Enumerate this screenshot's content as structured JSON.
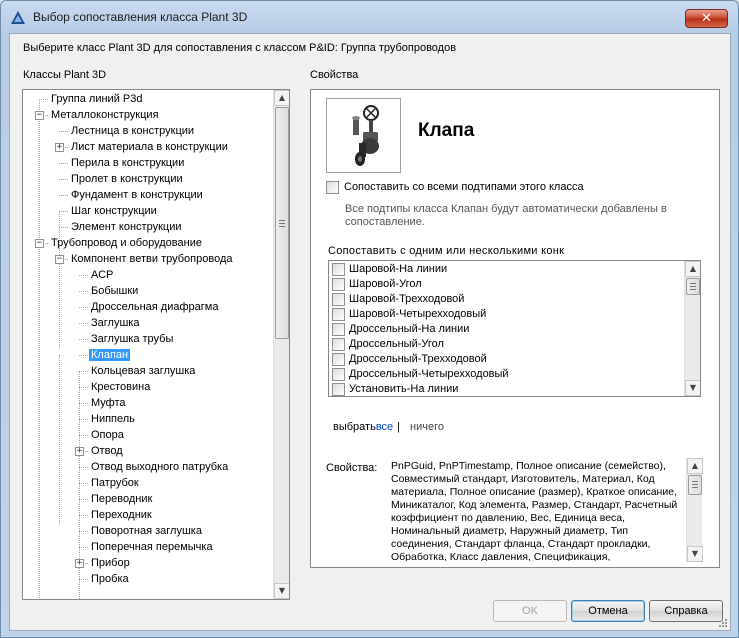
{
  "window": {
    "title": "Выбор сопоставления класса Plant 3D",
    "close_glyph": "✕"
  },
  "instruction": "Выберите класс Plant 3D для сопоставления с классом P&ID: Группа трубопроводов",
  "classes_label": "Классы Plant 3D",
  "properties_header": "Свойства",
  "tree": {
    "nodes": [
      {
        "label": "Группа линий P3d",
        "level": 0,
        "expander": ""
      },
      {
        "label": "Металлоконструкция",
        "level": 0,
        "expander": "−"
      },
      {
        "label": "Лестница в конструкции",
        "level": 1,
        "expander": ""
      },
      {
        "label": "Лист материала в конструкции",
        "level": 1,
        "expander": "+"
      },
      {
        "label": "Перила в конструкции",
        "level": 1,
        "expander": ""
      },
      {
        "label": "Пролет в конструкции",
        "level": 1,
        "expander": ""
      },
      {
        "label": "Фундамент в конструкции",
        "level": 1,
        "expander": ""
      },
      {
        "label": "Шаг конструкции",
        "level": 1,
        "expander": ""
      },
      {
        "label": "Элемент конструкции",
        "level": 1,
        "expander": ""
      },
      {
        "label": "Трубопровод и оборудование",
        "level": 0,
        "expander": "−"
      },
      {
        "label": "Компонент ветви трубопровода",
        "level": 1,
        "expander": "−"
      },
      {
        "label": "АСР",
        "level": 2,
        "expander": ""
      },
      {
        "label": "Бобышки",
        "level": 2,
        "expander": ""
      },
      {
        "label": "Дроссельная диафрагма",
        "level": 2,
        "expander": ""
      },
      {
        "label": "Заглушка",
        "level": 2,
        "expander": ""
      },
      {
        "label": "Заглушка трубы",
        "level": 2,
        "expander": ""
      },
      {
        "label": "Клапан",
        "level": 2,
        "expander": "",
        "selected": true
      },
      {
        "label": "Кольцевая заглушка",
        "level": 2,
        "expander": ""
      },
      {
        "label": "Крестовина",
        "level": 2,
        "expander": ""
      },
      {
        "label": "Муфта",
        "level": 2,
        "expander": ""
      },
      {
        "label": "Ниппель",
        "level": 2,
        "expander": ""
      },
      {
        "label": "Опора",
        "level": 2,
        "expander": ""
      },
      {
        "label": "Отвод",
        "level": 2,
        "expander": "+"
      },
      {
        "label": "Отвод выходного патрубка",
        "level": 2,
        "expander": ""
      },
      {
        "label": "Патрубок",
        "level": 2,
        "expander": ""
      },
      {
        "label": "Переводник",
        "level": 2,
        "expander": ""
      },
      {
        "label": "Переходник",
        "level": 2,
        "expander": ""
      },
      {
        "label": "Поворотная заглушка",
        "level": 2,
        "expander": ""
      },
      {
        "label": "Поперечная перемычка",
        "level": 2,
        "expander": ""
      },
      {
        "label": "Прибор",
        "level": 2,
        "expander": "+"
      },
      {
        "label": "Пробка",
        "level": 2,
        "expander": ""
      }
    ]
  },
  "class_panel": {
    "icon": "valve-icon",
    "class_name": "Клапа",
    "match_all_label": "Сопоставить со всеми подтипами этого класса",
    "match_all_checked": false,
    "note": "Все подтипы класса Клапан будут автоматически добавлены в сопоставление.",
    "list_label": "Сопоставить с одним или несколькими конк",
    "list_items": [
      "Шаровой-На линии",
      "Шаровой-Угол",
      "Шаровой-Трехходовой",
      "Шаровой-Четырехходовый",
      "Дроссельный-На линии",
      "Дроссельный-Угол",
      "Дроссельный-Трехходовой",
      "Дроссельный-Четырехходовый",
      "Установить-На линии"
    ],
    "select_prefix": "выбрать",
    "select_all": "все",
    "select_sep": "|",
    "select_none": "ничего",
    "properties_label": "Свойства:",
    "properties_text": "PnPGuid, PnPTimestamp, Полное описание (семейство), Совместимый стандарт, Изготовитель, Материал, Код материала, Полное описание (размер), Краткое описание, Миникаталог, Код элемента, Размер, Стандарт, Расчетный коэффициент по давлению, Вес, Единица веса, Номинальный диаметр, Наружный диаметр, Тип соединения, Стандарт фланца, Стандарт прокладки, Обработка, Класс давления, Спецификация,"
  },
  "buttons": {
    "ok": "OK",
    "cancel": "Отмена",
    "help": "Справка"
  },
  "colors": {
    "selection": "#3399ff",
    "link": "#0044cc",
    "close_button": "#c8452c"
  }
}
